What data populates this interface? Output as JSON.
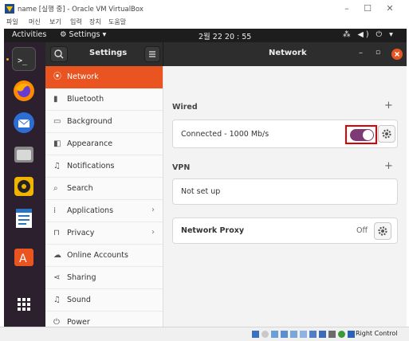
{
  "host_window": {
    "title": "name [실행 중] - Oracle VM VirtualBox",
    "menu": [
      "파일",
      "머신",
      "보기",
      "입력",
      "장치",
      "도움말"
    ],
    "controls": [
      "–",
      "☐",
      "✕"
    ],
    "status_host_key": "Right Control"
  },
  "topbar": {
    "activities": "Activities",
    "app_menu": "⚙ Settings ▾",
    "clock": "2월 22  20 : 55",
    "systray": "⁂ ◀) ⏻ ▾"
  },
  "dock": {
    "items": [
      "terminal",
      "firefox",
      "thunderbird",
      "files",
      "rhythmbox",
      "libreoffice-writer",
      "software-center",
      "show-apps"
    ]
  },
  "window": {
    "sidebar_title": "Settings",
    "content_title": "Network",
    "min_symbol": "–",
    "max_symbol": "▫"
  },
  "sidebar": {
    "items": [
      {
        "label": "Network",
        "icon": "network-icon",
        "glyph": "⦿",
        "selected": true
      },
      {
        "label": "Bluetooth",
        "icon": "bluetooth-icon",
        "glyph": "▮",
        "selected": false
      },
      {
        "label": "Background",
        "icon": "background-icon",
        "glyph": "▭",
        "selected": false
      },
      {
        "label": "Appearance",
        "icon": "appearance-icon",
        "glyph": "◧",
        "selected": false
      },
      {
        "label": "Notifications",
        "icon": "bell-icon",
        "glyph": "♫",
        "selected": false
      },
      {
        "label": "Search",
        "icon": "search-icon",
        "glyph": "⌕",
        "selected": false
      },
      {
        "label": "Applications",
        "icon": "apps-grid-icon",
        "glyph": "⁞",
        "selected": false,
        "chevron": "›"
      },
      {
        "label": "Privacy",
        "icon": "lock-icon",
        "glyph": "⊓",
        "selected": false,
        "chevron": "›"
      },
      {
        "label": "Online Accounts",
        "icon": "cloud-icon",
        "glyph": "☁",
        "selected": false
      },
      {
        "label": "Sharing",
        "icon": "share-icon",
        "glyph": "⋖",
        "selected": false
      },
      {
        "label": "Sound",
        "icon": "music-note-icon",
        "glyph": "♫",
        "selected": false
      },
      {
        "label": "Power",
        "icon": "power-icon",
        "glyph": "⏻",
        "selected": false
      }
    ]
  },
  "network": {
    "wired_title": "Wired",
    "wired_status": "Connected - 1000 Mb/s",
    "wired_enabled": true,
    "vpn_title": "VPN",
    "vpn_status": "Not set up",
    "proxy_title": "Network Proxy",
    "proxy_status": "Off",
    "add_symbol": "+"
  },
  "colors": {
    "accent": "#e95420",
    "toggle_on": "#7e3a74",
    "highlight_box": "#e00000",
    "dock_bg": "#2c1f2e",
    "topbar_bg": "#1d1d1d"
  }
}
